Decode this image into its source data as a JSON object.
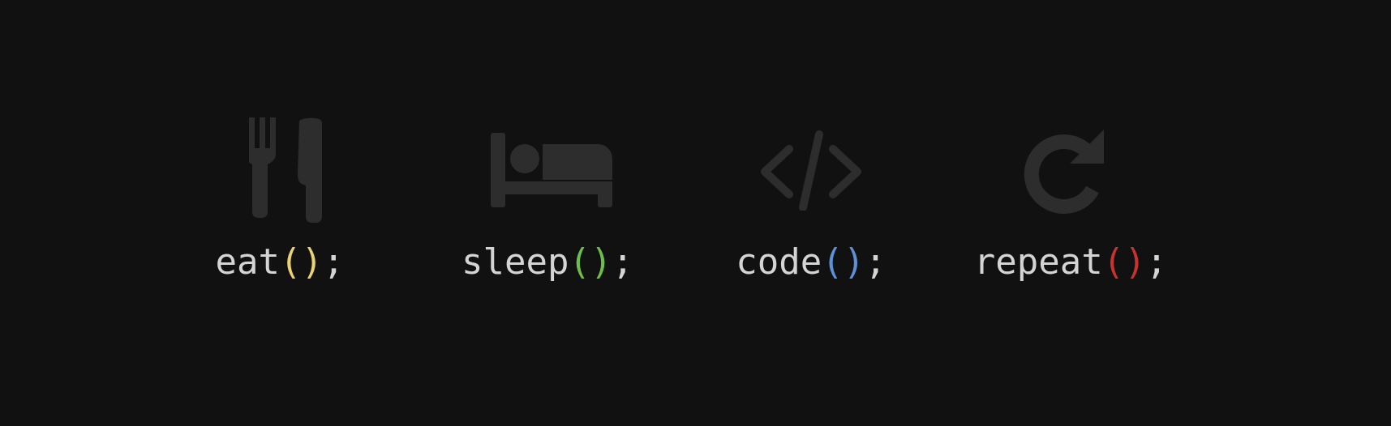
{
  "items": [
    {
      "name": "eat",
      "icon": "fork-knife-icon",
      "open": "(",
      "close": ")",
      "semicolon": ";",
      "paren_color": "#e8d36e"
    },
    {
      "name": "sleep",
      "icon": "bed-icon",
      "open": "(",
      "close": ")",
      "semicolon": ";",
      "paren_color": "#6cbf4a"
    },
    {
      "name": "code",
      "icon": "code-brackets-icon",
      "open": "(",
      "close": ")",
      "semicolon": ";",
      "paren_color": "#5b91d6"
    },
    {
      "name": "repeat",
      "icon": "redo-arrow-icon",
      "open": "(",
      "close": ")",
      "semicolon": ";",
      "paren_color": "#c8322f"
    }
  ],
  "colors": {
    "background": "#111111",
    "icon": "#2d2d2d",
    "text": "#d4d4d4"
  }
}
